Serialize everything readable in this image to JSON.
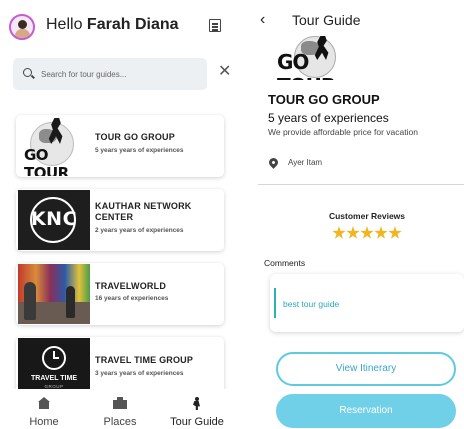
{
  "home": {
    "greeting_prefix": "Hello",
    "user_name": "Farah Diana",
    "search": {
      "placeholder": "Search for tour guides..."
    },
    "clear_icon": "close-icon",
    "guides": [
      {
        "name": "TOUR GO GROUP",
        "experience": "5  years years of experiences",
        "logo_text": "GO TOUR"
      },
      {
        "name": "KAUTHAR NETWORK CENTER",
        "experience": "2 years years of experiences",
        "logo_text": "KNC"
      },
      {
        "name": "TRAVELWORLD",
        "experience": "16 years of experiences"
      },
      {
        "name": "TRAVEL TIME GROUP",
        "experience": "3 years years of experiences",
        "logo_text": "TRAVEL TIME",
        "logo_subtext": "GROUP"
      }
    ],
    "nav": [
      {
        "label": "Home",
        "icon": "home-icon"
      },
      {
        "label": "Places",
        "icon": "places-icon"
      },
      {
        "label": "Tour Guide",
        "icon": "tour-guide-icon",
        "active": true
      }
    ]
  },
  "detail": {
    "title": "Tour Guide",
    "logo_text": "GO TOUR",
    "name": "TOUR GO GROUP",
    "experience": "5  years of experiences",
    "description": "We provide affordable price for vacation",
    "location": "Ayer Itam",
    "reviews_title": "Customer Reviews",
    "rating": 5,
    "comments_label": "Comments",
    "comments": [
      {
        "text": "best tour guide"
      }
    ],
    "view_itinerary_label": "View Itinerary",
    "reservation_label": "Reservation"
  },
  "colors": {
    "accent": "#5ccbe0",
    "accent_solid": "#6fd0e8",
    "star": "#f1b520",
    "avatar_ring": "#c45bd4"
  }
}
